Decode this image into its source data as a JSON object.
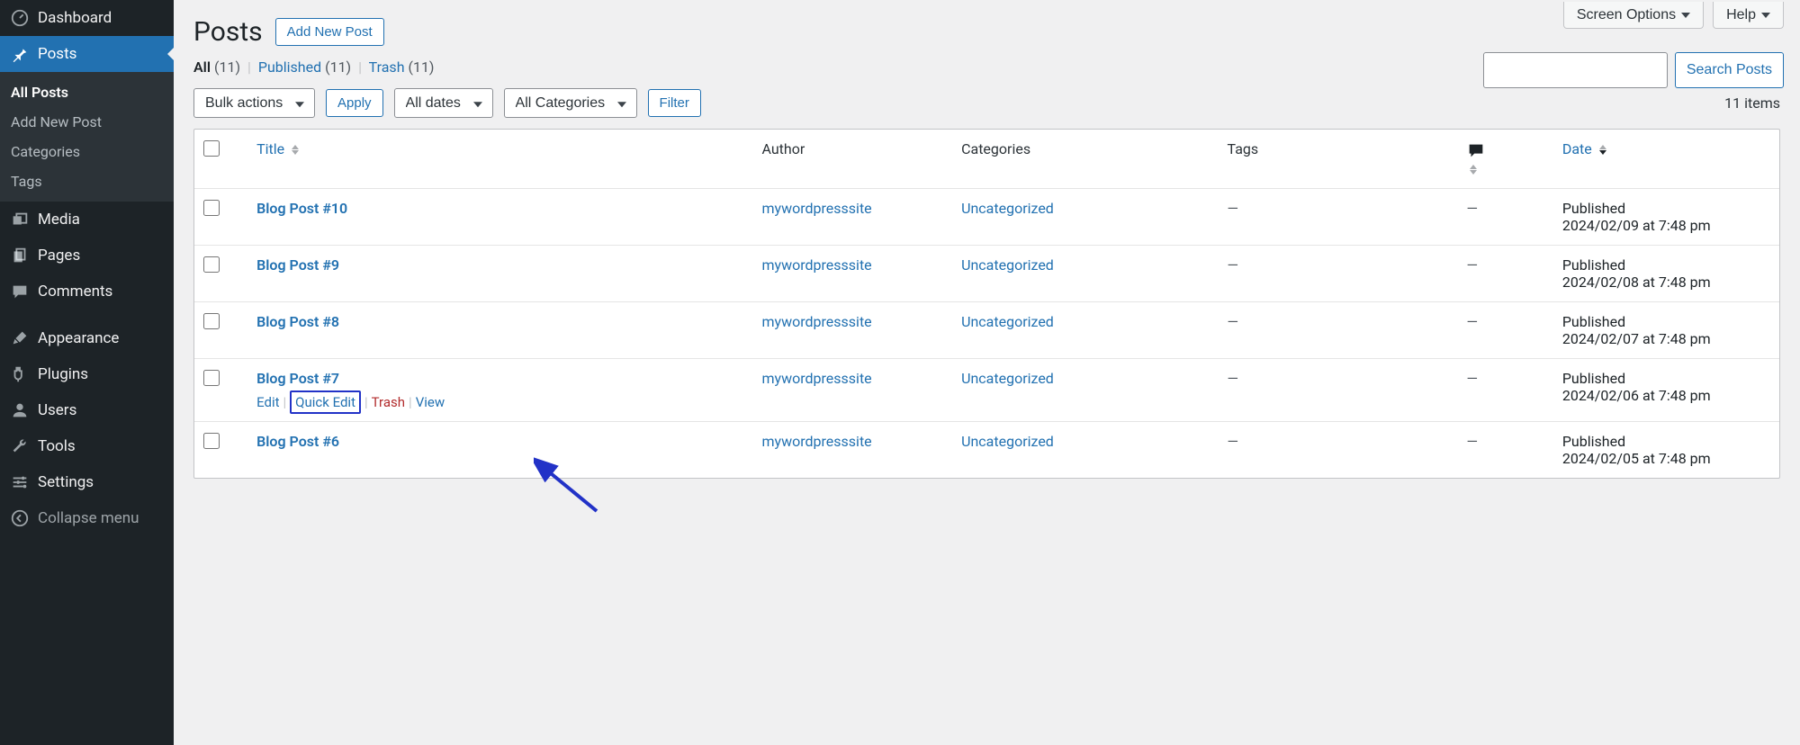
{
  "sidebar": {
    "items": [
      {
        "id": "dashboard",
        "label": "Dashboard",
        "icon": "dashboard-icon"
      },
      {
        "id": "posts",
        "label": "Posts",
        "icon": "pin-icon",
        "active": true
      },
      {
        "id": "media",
        "label": "Media",
        "icon": "media-icon"
      },
      {
        "id": "pages",
        "label": "Pages",
        "icon": "pages-icon"
      },
      {
        "id": "comments",
        "label": "Comments",
        "icon": "comment-icon"
      },
      {
        "id": "appearance",
        "label": "Appearance",
        "icon": "brush-icon"
      },
      {
        "id": "plugins",
        "label": "Plugins",
        "icon": "plug-icon"
      },
      {
        "id": "users",
        "label": "Users",
        "icon": "user-icon"
      },
      {
        "id": "tools",
        "label": "Tools",
        "icon": "wrench-icon"
      },
      {
        "id": "settings",
        "label": "Settings",
        "icon": "sliders-icon"
      },
      {
        "id": "collapse",
        "label": "Collapse menu",
        "icon": "collapse-icon"
      }
    ],
    "submenu": {
      "items": [
        {
          "label": "All Posts",
          "current": true
        },
        {
          "label": "Add New Post"
        },
        {
          "label": "Categories"
        },
        {
          "label": "Tags"
        }
      ]
    }
  },
  "topright": {
    "screen_options": "Screen Options",
    "help": "Help"
  },
  "page": {
    "title": "Posts",
    "add_new": "Add New Post"
  },
  "views": {
    "all_label": "All",
    "all_count": "(11)",
    "published_label": "Published",
    "published_count": "(11)",
    "trash_label": "Trash",
    "trash_count": "(11)"
  },
  "search": {
    "button": "Search Posts"
  },
  "filters": {
    "bulk": "Bulk actions",
    "apply": "Apply",
    "dates": "All dates",
    "cats": "All Categories",
    "filter": "Filter"
  },
  "count_text": "11 items",
  "columns": {
    "title": "Title",
    "author": "Author",
    "categories": "Categories",
    "tags": "Tags",
    "date": "Date"
  },
  "row_actions": {
    "edit": "Edit",
    "quick_edit": "Quick Edit",
    "trash": "Trash",
    "view": "View"
  },
  "posts": [
    {
      "title": "Blog Post #10",
      "author": "mywordpresssite",
      "category": "Uncategorized",
      "tags": "—",
      "comments": "—",
      "date_status": "Published",
      "date": "2024/02/09 at 7:48 pm"
    },
    {
      "title": "Blog Post #9",
      "author": "mywordpresssite",
      "category": "Uncategorized",
      "tags": "—",
      "comments": "—",
      "date_status": "Published",
      "date": "2024/02/08 at 7:48 pm"
    },
    {
      "title": "Blog Post #8",
      "author": "mywordpresssite",
      "category": "Uncategorized",
      "tags": "—",
      "comments": "—",
      "date_status": "Published",
      "date": "2024/02/07 at 7:48 pm"
    },
    {
      "title": "Blog Post #7",
      "author": "mywordpresssite",
      "category": "Uncategorized",
      "tags": "—",
      "comments": "—",
      "date_status": "Published",
      "date": "2024/02/06 at 7:48 pm",
      "show_actions": true
    },
    {
      "title": "Blog Post #6",
      "author": "mywordpresssite",
      "category": "Uncategorized",
      "tags": "—",
      "comments": "—",
      "date_status": "Published",
      "date": "2024/02/05 at 7:48 pm"
    }
  ]
}
